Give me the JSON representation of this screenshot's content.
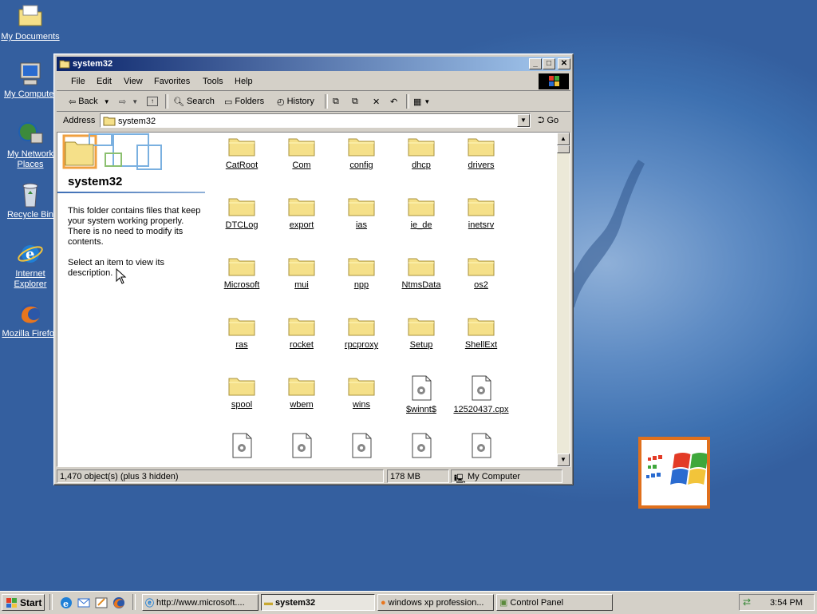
{
  "desktop_icons": [
    {
      "label": "My Documents",
      "icon": "my-documents-icon"
    },
    {
      "label": "My Computer",
      "icon": "my-computer-icon"
    },
    {
      "label": "My Network Places",
      "icon": "network-places-icon"
    },
    {
      "label": "Recycle Bin",
      "icon": "recycle-bin-icon"
    },
    {
      "label": "Internet Explorer",
      "icon": "internet-explorer-icon"
    },
    {
      "label": "Mozilla Firefox",
      "icon": "firefox-icon"
    }
  ],
  "window": {
    "title": "system32",
    "menu": [
      "File",
      "Edit",
      "View",
      "Favorites",
      "Tools",
      "Help"
    ],
    "toolbar": {
      "back": "Back",
      "search": "Search",
      "folders": "Folders",
      "history": "History"
    },
    "address": {
      "label": "Address",
      "value": "system32",
      "go": "Go"
    },
    "left_pane": {
      "title": "system32",
      "desc1": "This folder contains files that keep your system working properly. There is no need to modify its contents.",
      "desc2": "Select an item to view its description."
    },
    "items": [
      {
        "label": "CatRoot",
        "type": "folder"
      },
      {
        "label": "Com",
        "type": "folder"
      },
      {
        "label": "config",
        "type": "folder"
      },
      {
        "label": "dhcp",
        "type": "folder"
      },
      {
        "label": "drivers",
        "type": "folder"
      },
      {
        "label": "DTCLog",
        "type": "folder"
      },
      {
        "label": "export",
        "type": "folder"
      },
      {
        "label": "ias",
        "type": "folder"
      },
      {
        "label": "ie_de",
        "type": "folder"
      },
      {
        "label": "inetsrv",
        "type": "folder"
      },
      {
        "label": "Microsoft",
        "type": "folder"
      },
      {
        "label": "mui",
        "type": "folder"
      },
      {
        "label": "npp",
        "type": "folder"
      },
      {
        "label": "NtmsData",
        "type": "folder"
      },
      {
        "label": "os2",
        "type": "folder"
      },
      {
        "label": "ras",
        "type": "folder"
      },
      {
        "label": "rocket",
        "type": "folder"
      },
      {
        "label": "rpcproxy",
        "type": "folder"
      },
      {
        "label": "Setup",
        "type": "folder"
      },
      {
        "label": "ShellExt",
        "type": "folder"
      },
      {
        "label": "spool",
        "type": "folder"
      },
      {
        "label": "wbem",
        "type": "folder"
      },
      {
        "label": "wins",
        "type": "folder"
      },
      {
        "label": "$winnt$",
        "type": "file"
      },
      {
        "label": "12520437.cpx",
        "type": "file"
      },
      {
        "label": "",
        "type": "file"
      },
      {
        "label": "...",
        "type": "file"
      },
      {
        "label": "",
        "type": "file"
      },
      {
        "label": "",
        "type": "file"
      },
      {
        "label": "",
        "type": "file"
      }
    ],
    "status": {
      "objects": "1,470 object(s) (plus 3 hidden)",
      "size": "178 MB",
      "location": "My Computer"
    }
  },
  "taskbar": {
    "start": "Start",
    "tasks": [
      "http://www.microsoft....",
      "system32",
      "windows xp profession...",
      "Control Panel"
    ],
    "clock": "3:54 PM"
  },
  "colors": {
    "desktop": "#3a6ea5",
    "titlebar_start": "#0a246a",
    "titlebar_end": "#a6caf0",
    "folder": "#f5e089"
  }
}
